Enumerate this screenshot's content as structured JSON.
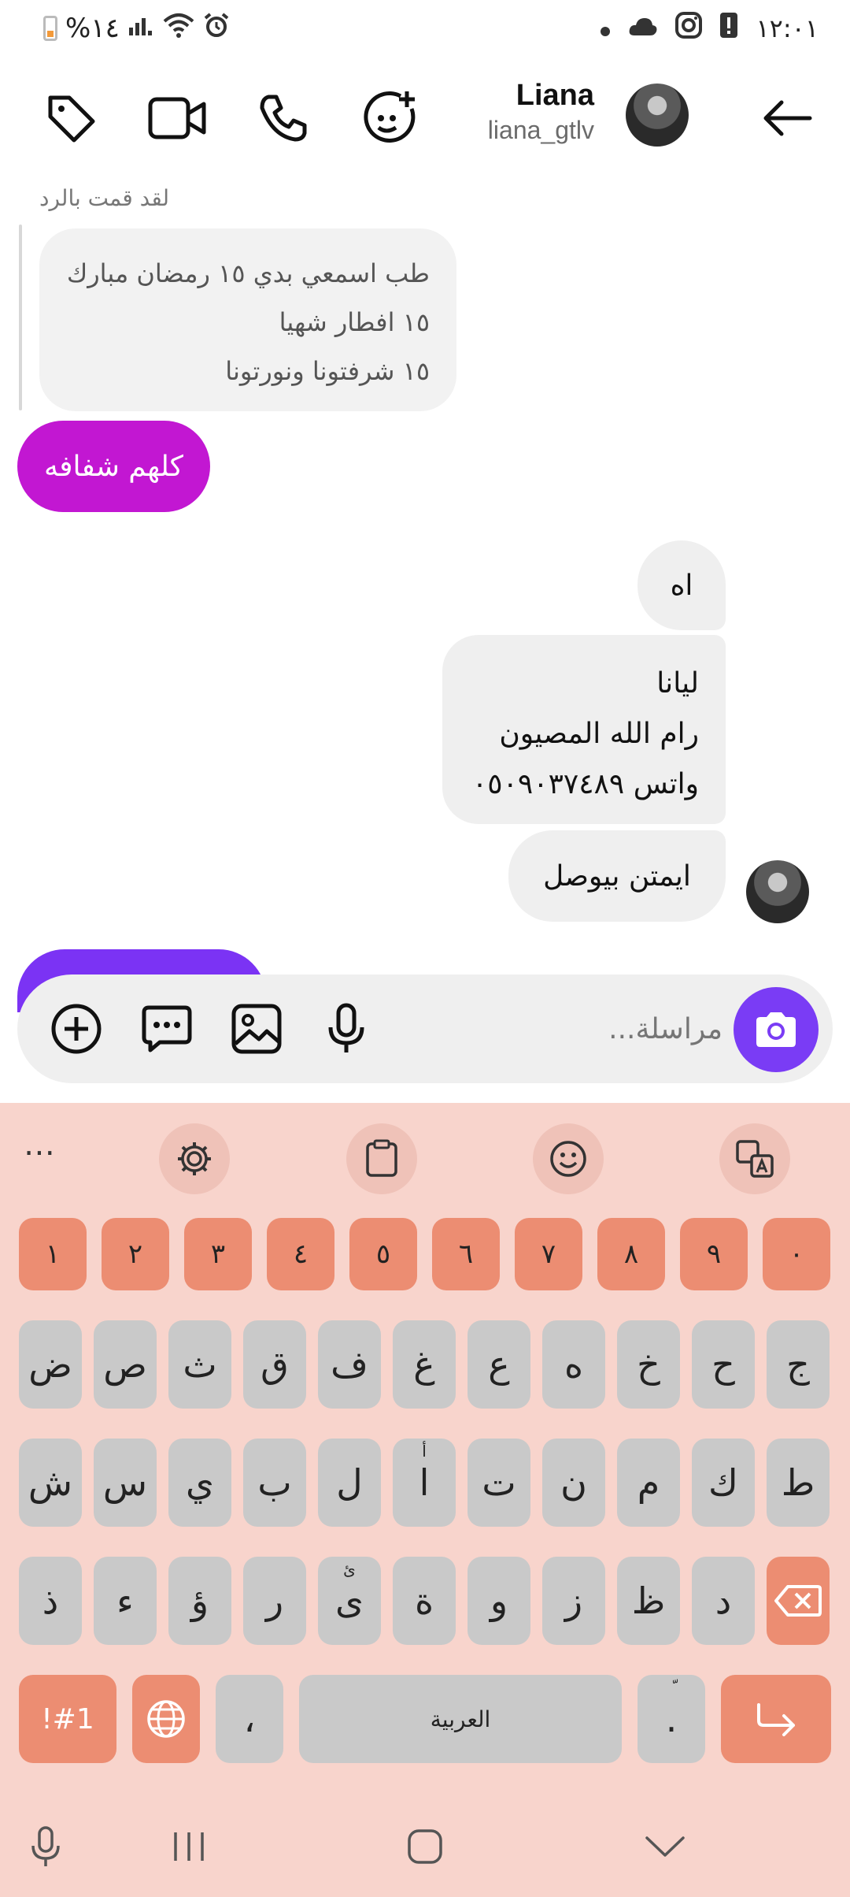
{
  "status_bar": {
    "battery_percent": "%١٤",
    "time": "١٢:٠١"
  },
  "header": {
    "name": "Liana",
    "username": "liana_gtlv"
  },
  "thread": {
    "reply_label": "لقد قمت بالرد",
    "replied_lines": [
      "طب اسمعي بدي ١٥ رمضان مبارك",
      "١٥ افطار شهيا",
      "١٥ شرفتونا ونورتونا"
    ],
    "outgoing_message": "كلهم شفافه",
    "incoming": [
      {
        "lines": [
          "اه"
        ]
      },
      {
        "lines": [
          "ليانا",
          "رام الله المصيون",
          "واتس ٠٥٠٩٠٣٧٤٨٩"
        ]
      },
      {
        "lines": [
          "ايمتن بيوصل"
        ]
      }
    ]
  },
  "composer": {
    "placeholder": "مراسلة..."
  },
  "keyboard": {
    "dots": "⋯",
    "numbers": [
      "١",
      "٢",
      "٣",
      "٤",
      "٥",
      "٦",
      "٧",
      "٨",
      "٩",
      "٠"
    ],
    "row1": [
      "ض",
      "ص",
      "ث",
      "ق",
      "ف",
      "غ",
      "ع",
      "ه",
      "خ",
      "ح",
      "ج"
    ],
    "row2": [
      "ش",
      "س",
      "ي",
      "ب",
      "ل",
      "ا",
      "ت",
      "ن",
      "م",
      "ك",
      "ط"
    ],
    "row2_alif_mark": "أ",
    "row3": [
      "ذ",
      "ء",
      "ؤ",
      "ر",
      "ى",
      "ة",
      "و",
      "ز",
      "ظ",
      "د"
    ],
    "row3_ya_mark": "ئ",
    "symbols_key": "!#1",
    "comma_key": "،",
    "space_label": "العربية",
    "period_key": ".",
    "period_mark": "ّ"
  },
  "colors": {
    "outgoing_bubble": "#c217d2",
    "camera_button": "#7a3cf5",
    "keyboard_bg": "#f8d4cc",
    "accent_key": "#ec8d72",
    "key": "#c9c9c9"
  }
}
